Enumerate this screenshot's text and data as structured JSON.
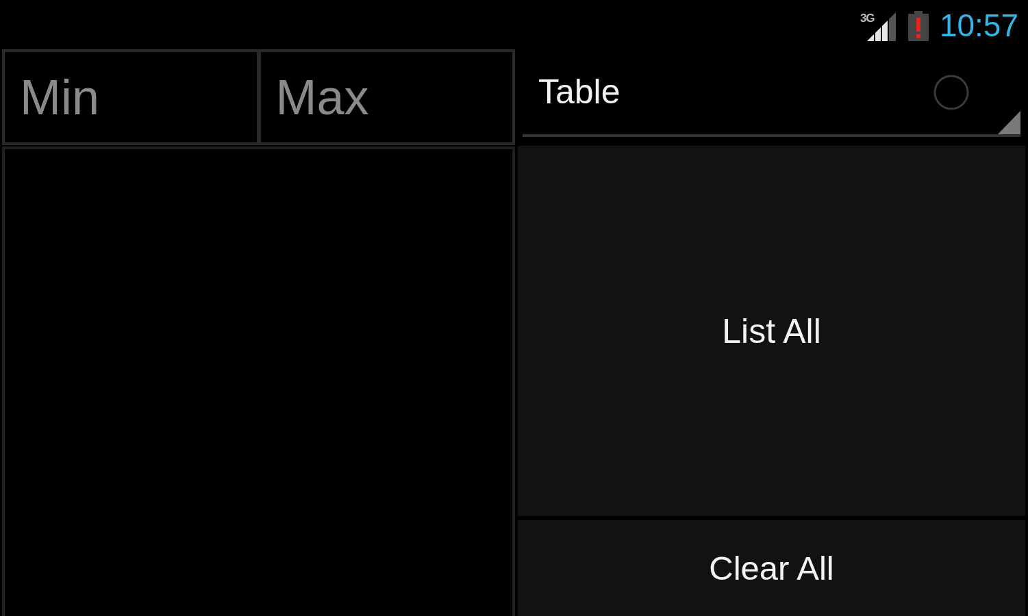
{
  "status_bar": {
    "network": "3G",
    "time": "10:57"
  },
  "fields": [
    {
      "placeholder": "Min"
    },
    {
      "placeholder": "Max"
    }
  ],
  "dropdown": {
    "value": "Table",
    "checked": false
  },
  "buttons": [
    {
      "label": "List All",
      "kind": "large"
    },
    {
      "label": "Clear All",
      "kind": "small"
    }
  ]
}
